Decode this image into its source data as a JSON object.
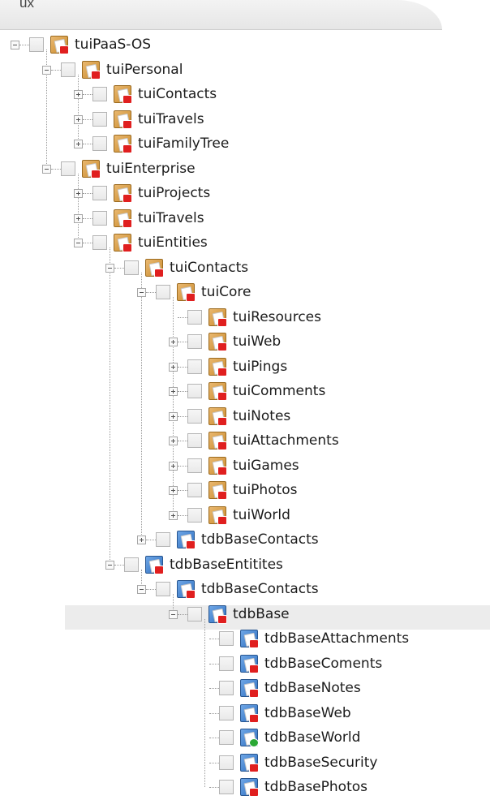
{
  "header": {
    "tab_label": "ux"
  },
  "tree": [
    {
      "label": "tuiPaaS-OS",
      "expander": "minus",
      "icon": "tui-folder-icon",
      "level": 0
    },
    {
      "label": "tuiPersonal",
      "expander": "minus",
      "icon": "tui-folder-icon",
      "level": 1
    },
    {
      "label": "tuiContacts",
      "expander": "plus",
      "icon": "tui-folder-icon",
      "level": 2
    },
    {
      "label": "tuiTravels",
      "expander": "plus",
      "icon": "tui-folder-icon",
      "level": 2
    },
    {
      "label": "tuiFamilyTree",
      "expander": "plus",
      "icon": "tui-folder-icon",
      "level": 2
    },
    {
      "label": "tuiEnterprise",
      "expander": "minus",
      "icon": "tui-folder-icon",
      "level": 1
    },
    {
      "label": "tuiProjects",
      "expander": "plus",
      "icon": "tui-folder-icon",
      "level": 2
    },
    {
      "label": "tuiTravels",
      "expander": "plus",
      "icon": "tui-folder-icon",
      "level": 2
    },
    {
      "label": "tuiEntities",
      "expander": "minus",
      "icon": "tui-folder-icon",
      "level": 2
    },
    {
      "label": "tuiContacts",
      "expander": "minus",
      "icon": "tui-folder-icon",
      "level": 3
    },
    {
      "label": "tuiCore",
      "expander": "minus",
      "icon": "tui-folder-icon",
      "level": 4
    },
    {
      "label": "tuiResources",
      "expander": "none",
      "icon": "tui-folder-icon",
      "level": 5
    },
    {
      "label": "tuiWeb",
      "expander": "plus",
      "icon": "tui-folder-icon",
      "level": 5
    },
    {
      "label": "tuiPings",
      "expander": "plus",
      "icon": "tui-folder-icon",
      "level": 5
    },
    {
      "label": "tuiComments",
      "expander": "plus",
      "icon": "tui-folder-icon",
      "level": 5
    },
    {
      "label": "tuiNotes",
      "expander": "plus",
      "icon": "tui-folder-icon",
      "level": 5
    },
    {
      "label": "tuiAttachments",
      "expander": "plus",
      "icon": "tui-folder-icon",
      "level": 5
    },
    {
      "label": "tuiGames",
      "expander": "plus",
      "icon": "tui-folder-icon",
      "level": 5
    },
    {
      "label": "tuiPhotos",
      "expander": "plus",
      "icon": "tui-folder-icon",
      "level": 5
    },
    {
      "label": "tuiWorld",
      "expander": "plus",
      "icon": "tui-folder-icon",
      "level": 5
    },
    {
      "label": "tdbBaseContacts",
      "expander": "plus",
      "icon": "tdb-folder-icon",
      "level": 4
    },
    {
      "label": "tdbBaseEntitites",
      "expander": "minus",
      "icon": "tdb-folder-icon",
      "level": 3
    },
    {
      "label": "tdbBaseContacts",
      "expander": "minus",
      "icon": "tdb-folder-icon",
      "level": 4
    },
    {
      "label": "tdbBase",
      "expander": "minus",
      "icon": "tdb-folder-icon",
      "level": 5,
      "selected": true
    },
    {
      "label": "tdbBaseAttachments",
      "expander": "none",
      "icon": "tdb-folder-icon",
      "level": 6
    },
    {
      "label": "tdbBaseComents",
      "expander": "none",
      "icon": "tdb-folder-icon",
      "level": 6
    },
    {
      "label": "tdbBaseNotes",
      "expander": "none",
      "icon": "tdb-folder-icon",
      "level": 6
    },
    {
      "label": "tdbBaseWeb",
      "expander": "none",
      "icon": "tdb-folder-icon",
      "level": 6
    },
    {
      "label": "tdbBaseWorld",
      "expander": "none",
      "icon": "tdb-folder-icon",
      "level": 6,
      "badge": "check"
    },
    {
      "label": "tdbBaseSecurity",
      "expander": "none",
      "icon": "tdb-folder-icon",
      "level": 6
    },
    {
      "label": "tdbBasePhotos",
      "expander": "none",
      "icon": "tdb-folder-icon",
      "level": 6
    }
  ]
}
